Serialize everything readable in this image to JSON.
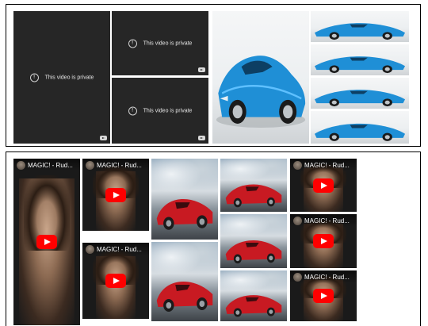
{
  "private_video": {
    "message": "This video is private",
    "info_glyph": "!",
    "icon": "info-icon",
    "badge_icon": "youtube-logo-icon"
  },
  "youtube_video": {
    "title": "MAGIC! - Rud...",
    "play_icon": "play-icon",
    "channel_icon": "channel-avatar"
  },
  "colors": {
    "private_bg": "#262626",
    "youtube_red": "#ff0000",
    "ferrari_blue": "#1f8fd6",
    "ferrari_red": "#c81a22"
  }
}
